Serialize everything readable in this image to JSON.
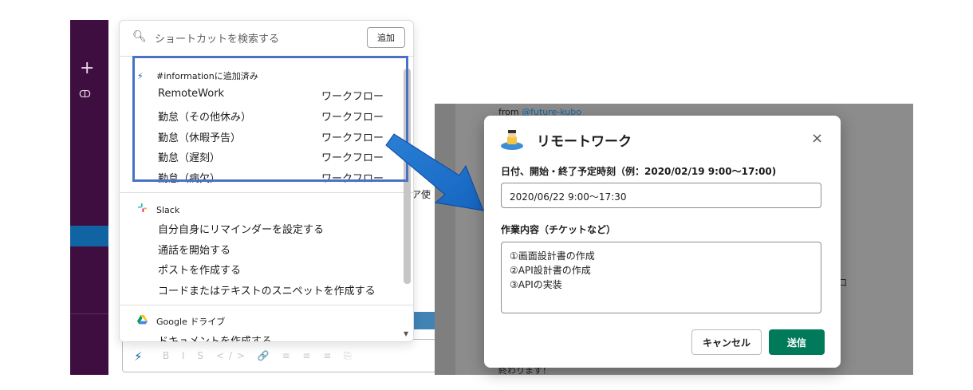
{
  "sidebar": {
    "plus_icon": "+",
    "connect_icon": "ↀ"
  },
  "background": {
    "partial_text": "ア使"
  },
  "menu": {
    "search_placeholder": "ショートカットを検索する",
    "add_button": "追加",
    "sections": [
      {
        "header": "#informationに追加済み",
        "icon": "bolt-icon",
        "items": [
          {
            "label": "RemoteWork",
            "type": "ワークフロー"
          },
          {
            "label": "勤怠（その他休み）",
            "type": "ワークフロー"
          },
          {
            "label": "勤怠（休暇予告）",
            "type": "ワークフロー"
          },
          {
            "label": "勤怠（遅刻）",
            "type": "ワークフロー"
          },
          {
            "label": "勤怠（病欠）",
            "type": "ワークフロー"
          }
        ]
      },
      {
        "header": "Slack",
        "icon": "slack-icon",
        "items": [
          {
            "label": "自分自身にリマインダーを設定する"
          },
          {
            "label": "通話を開始する"
          },
          {
            "label": "ポストを作成する"
          },
          {
            "label": "コードまたはテキストのスニペットを作成する"
          }
        ]
      },
      {
        "header": "Google ドライブ",
        "icon": "google-drive-icon",
        "items": [
          {
            "label": "ドキュメントを作成する"
          }
        ]
      }
    ]
  },
  "composer": {
    "tools": "B I S </> 🔗 ≡ ≡ ≡ ⎘"
  },
  "channel": {
    "from_prefix": "from ",
    "from_user": "@future-kubo",
    "partial_message": "終わります！",
    "kanji": "口"
  },
  "modal": {
    "title": "リモートワーク",
    "field1_label": "日付、開始・終了予定時刻（例：2020/02/19 9:00〜17:00)",
    "field1_value": "2020/06/22 9:00〜17:30",
    "field2_label": "作業内容（チケットなど）",
    "field2_lines": [
      "①画面設計書の作成",
      "②API設計書の作成",
      "③APIの実装"
    ],
    "cancel_label": "キャンセル",
    "submit_label": "送信",
    "close_icon": "×"
  },
  "colors": {
    "sidebar": "#3f0e40",
    "highlight": "#4a72c4",
    "submit": "#007a5a",
    "link": "#1264a3"
  }
}
